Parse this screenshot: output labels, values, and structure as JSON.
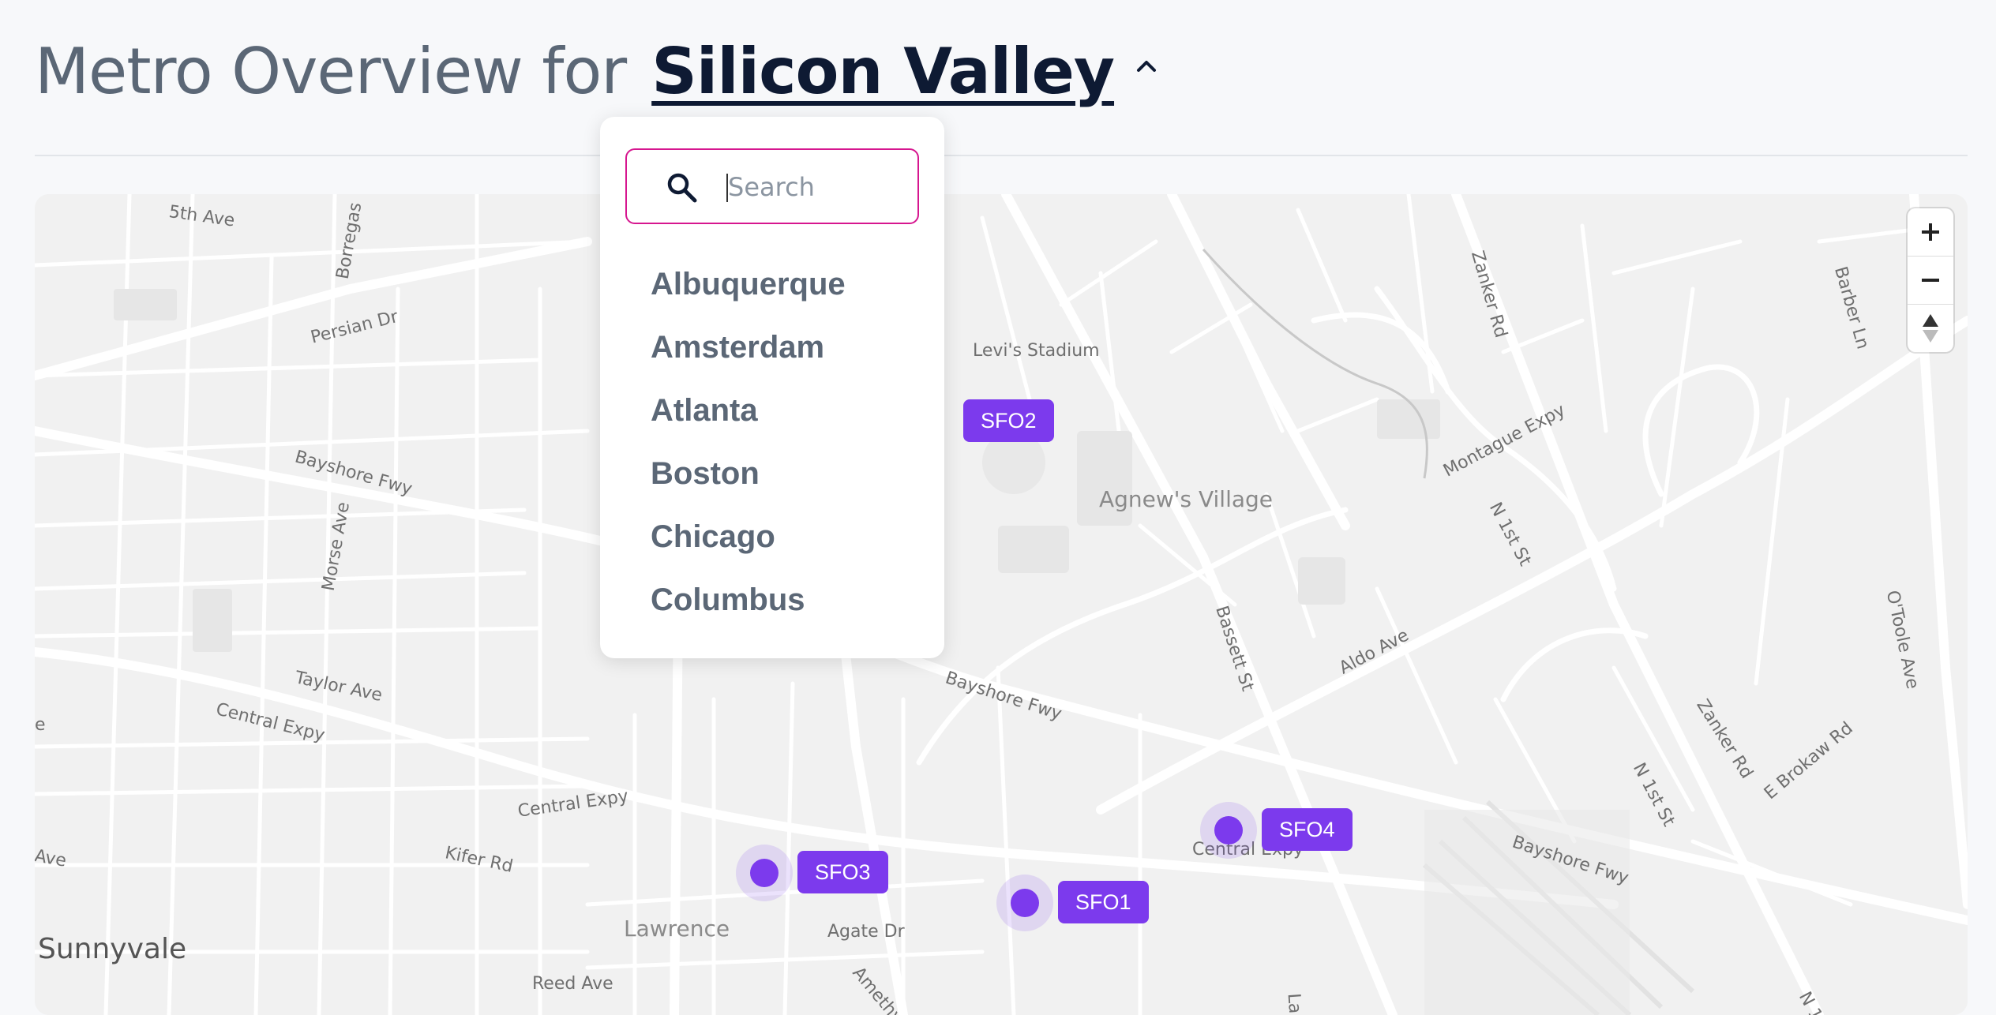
{
  "header": {
    "title_prefix": "Metro Overview for",
    "selected_metro": "Silicon Valley"
  },
  "dropdown": {
    "search_placeholder": "Search",
    "items": [
      "Albuquerque",
      "Amsterdam",
      "Atlanta",
      "Boston",
      "Chicago",
      "Columbus"
    ]
  },
  "map": {
    "zoom_in": "+",
    "zoom_out": "−",
    "compass": "▲",
    "markers": [
      "SFO1",
      "SFO2",
      "SFO3",
      "SFO4"
    ],
    "labels": {
      "fifth_ave": "5th Ave",
      "borregas": "Borregas",
      "persian_dr": "Persian Dr",
      "bayshore_fwy_w": "Bayshore Fwy",
      "morse_ave": "Morse Ave",
      "taylor_ave": "Taylor Ave",
      "central_expy_w": "Central Expy",
      "central_expy_mid": "Central Expy",
      "kifer_rd": "Kifer Rd",
      "ave_left": "Ave",
      "e_left": "e",
      "levis_stadium": "Levi's Stadium",
      "agnews_village": "Agnew's Village",
      "bassett_st": "Bassett St",
      "aldo_ave": "Aldo Ave",
      "bayshore_fwy_mid": "Bayshore Fwy",
      "central_expy_e": "Central Expy",
      "zanker_rd_top": "Zanker Rd",
      "montague_expy": "Montague Expy",
      "n_1st_st_top": "N 1st St",
      "barber_ln": "Barber Ln",
      "otoole_ave": "O'Toole Ave",
      "zanker_rd_bottom": "Zanker Rd",
      "n_1st_st_bottom": "N 1st St",
      "e_brokaw_rd": "E Brokaw Rd",
      "bayshore_fwy_e": "Bayshore Fwy",
      "lawrence": "Lawrence",
      "agate_dr": "Agate Dr",
      "amethyst": "Amethy",
      "reed_ave": "Reed Ave",
      "la_partial": "La",
      "n1_partial": "N 1",
      "sunnyvale": "Sunnyvale"
    }
  },
  "colors": {
    "accent_purple": "#7c3aed",
    "search_border": "#d6168f",
    "title_dark": "#0e1a33",
    "title_gray": "#5b6776"
  }
}
